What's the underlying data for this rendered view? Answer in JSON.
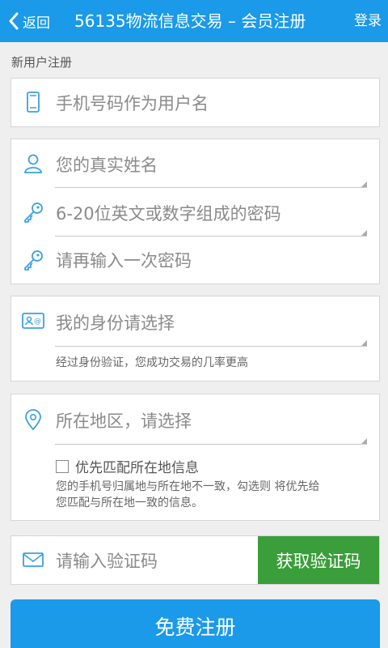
{
  "header": {
    "back_label": "返回",
    "title": "56135物流信息交易 – 会员注册",
    "login_label": "登录"
  },
  "section_label": "新用户注册",
  "fields": {
    "phone_placeholder": "手机号码作为用户名",
    "realname_placeholder": "您的真实姓名",
    "password_placeholder": "6-20位英文或数字组成的密码",
    "password_confirm_placeholder": "请再输入一次密码",
    "identity_placeholder": "我的身份请选择",
    "identity_hint": "经过身份验证，您成功交易的几率更高",
    "region_placeholder": "所在地区，请选择",
    "region_checkbox_label": "优先匹配所在地信息",
    "region_hint_line1": "您的手机号归属地与所在地不一致，勾选则  将优先给",
    "region_hint_line2": "您匹配与所在地一致的信息。",
    "code_placeholder": "请输入验证码",
    "get_code_label": "获取验证码"
  },
  "submit_label": "免费注册",
  "colors": {
    "header_bg": "#1a9ae8",
    "icon": "#3aa0e0",
    "get_code_bg": "#3a9e3a",
    "submit_bg": "#1a9ae8"
  },
  "icons": {
    "back": "chevron-left-icon",
    "phone": "phone-icon",
    "user": "user-icon",
    "key": "key-icon",
    "id_card": "id-card-icon",
    "location": "location-pin-icon",
    "mail": "mail-icon"
  }
}
